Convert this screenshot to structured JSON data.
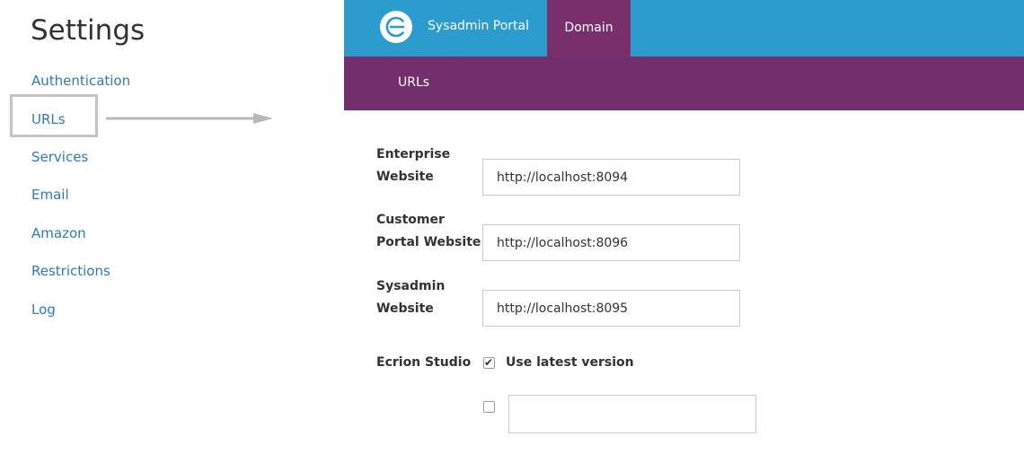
{
  "settings": {
    "title": "Settings",
    "nav": [
      {
        "label": "Authentication"
      },
      {
        "label": "URLs"
      },
      {
        "label": "Services"
      },
      {
        "label": "Email"
      },
      {
        "label": "Amazon"
      },
      {
        "label": "Restrictions"
      },
      {
        "label": "Log"
      }
    ]
  },
  "app": {
    "portal_name": "Sysadmin Portal",
    "logo_icon": "ecrion-logo-icon",
    "tabs": [
      {
        "label": "Domain",
        "active": true
      }
    ],
    "subtabs": [
      {
        "label": "URLs"
      }
    ],
    "colors": {
      "topbar": "#2b9ccd",
      "subbar": "#722f6b",
      "active_tab": "#7a2f6d",
      "link": "#2e7bb7"
    }
  },
  "form": {
    "enterprise": {
      "label_line1": "Enterprise",
      "label_line2": "Website",
      "value": "http://localhost:8094"
    },
    "customer": {
      "label_line1": "Customer",
      "label_line2": "Portal Website",
      "value": "http://localhost:8096"
    },
    "sysadmin": {
      "label_line1": "Sysadmin",
      "label_line2": "Website",
      "value": "http://localhost:8095"
    },
    "studio": {
      "label": "Ecrion Studio",
      "use_latest_label": "Use latest version",
      "use_latest_checked": true,
      "custom_checked": false,
      "custom_value": ""
    }
  }
}
